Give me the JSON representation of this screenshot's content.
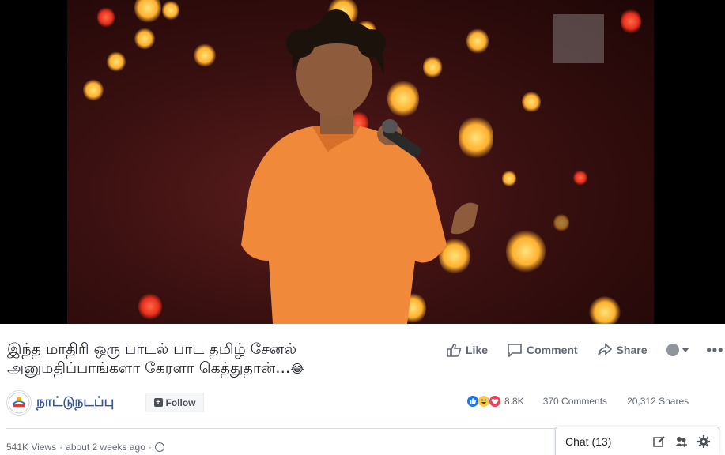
{
  "video": {
    "overlay_icon": "watermark-logo"
  },
  "post": {
    "title_line1": "இந்த மாதிரி ஒரு பாடல் பாட தமிழ் சேனல்",
    "title_line2": "அனுமதிப்பாங்களா கேரளா கெத்துதான்…",
    "title_emoji": "😂"
  },
  "actions": {
    "like": "Like",
    "comment": "Comment",
    "share": "Share",
    "more": "•••"
  },
  "page": {
    "name": "நாட்டுநடப்பு",
    "follow": "Follow"
  },
  "stats": {
    "reactions": "8.8K",
    "comments": "370 Comments",
    "shares": "20,312 Shares"
  },
  "meta": {
    "views": "541K Views",
    "separator": "·",
    "time": "about 2 weeks ago",
    "separator2": "·"
  },
  "chat": {
    "label": "Chat (13)"
  },
  "colors": {
    "link": "#365899",
    "like": "#1877f2",
    "love": "#f33e58",
    "haha": "#f7c94b"
  }
}
